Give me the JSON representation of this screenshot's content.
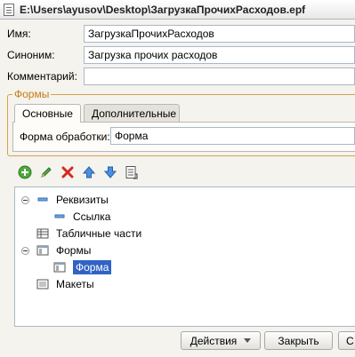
{
  "window": {
    "title": "E:\\Users\\ayusov\\Desktop\\ЗагрузкаПрочихРасходов.epf"
  },
  "fields": {
    "name_label": "Имя:",
    "name_value": "ЗагрузкаПрочихРасходов",
    "synonym_label": "Синоним:",
    "synonym_value": "Загрузка прочих расходов",
    "comment_label": "Комментарий:",
    "comment_value": ""
  },
  "forms_group": {
    "title": "Формы",
    "tabs": [
      {
        "label": "Основные",
        "active": true
      },
      {
        "label": "Дополнительные",
        "active": false
      }
    ],
    "form_label": "Форма обработки:",
    "form_value": "Форма"
  },
  "toolbar": {
    "buttons": [
      "add-icon",
      "edit-icon",
      "delete-icon",
      "move-up-icon",
      "move-down-icon",
      "properties-icon"
    ]
  },
  "tree": {
    "items": [
      {
        "label": "Реквизиты",
        "expanded": true
      },
      {
        "label": "Ссылка"
      },
      {
        "label": "Табличные части"
      },
      {
        "label": "Формы",
        "expanded": true
      },
      {
        "label": "Форма",
        "selected": true
      },
      {
        "label": "Макеты"
      }
    ]
  },
  "buttons": {
    "actions": "Действия",
    "close": "Закрыть",
    "partial": "С"
  },
  "colors": {
    "accent_orange": "#c47a10",
    "selection": "#3163c5",
    "field_border": "#a9b8c8"
  }
}
